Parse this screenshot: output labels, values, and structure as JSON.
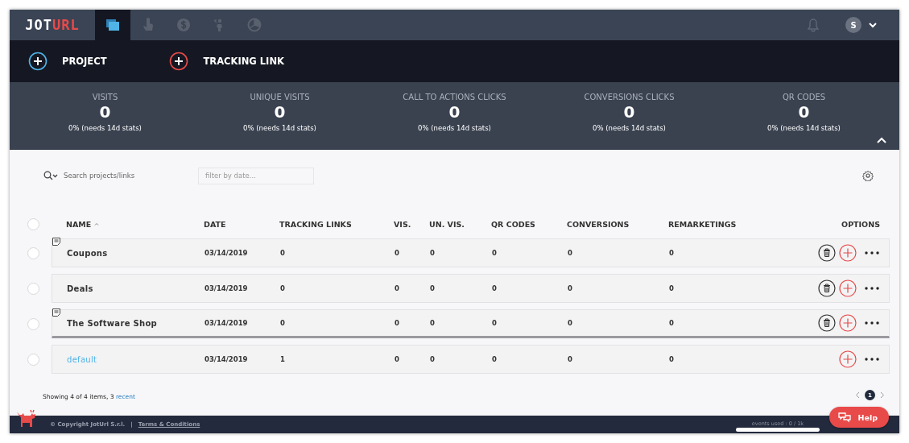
{
  "topbar": {
    "logo": {
      "left": "JOT",
      "right": "URL"
    },
    "tabs": [
      {
        "kind": "folder",
        "selected": true
      },
      {
        "kind": "hand",
        "selected": false
      },
      {
        "kind": "dollar",
        "selected": false
      },
      {
        "kind": "person",
        "selected": false
      },
      {
        "kind": "pie",
        "selected": false
      }
    ],
    "user": {
      "initial": "S"
    }
  },
  "actions": [
    {
      "label": "PROJECT",
      "color": "#4fb3e8"
    },
    {
      "label": "TRACKING LINK",
      "color": "#e84a4a"
    }
  ],
  "stats": [
    {
      "label": "VISITS",
      "value": "0",
      "note": "0% (needs 14d stats)"
    },
    {
      "label": "UNIQUE VISITS",
      "value": "0",
      "note": "0% (needs 14d stats)"
    },
    {
      "label": "CALL TO ACTIONS CLICKS",
      "value": "0",
      "note": "0% (needs 14d stats)"
    },
    {
      "label": "CONVERSIONS CLICKS",
      "value": "0",
      "note": "0% (needs 14d stats)"
    },
    {
      "label": "QR CODES",
      "value": "0",
      "note": "0% (needs 14d stats)"
    }
  ],
  "filters": {
    "search_placeholder": "Search projects/links",
    "date_placeholder": "filter by date..."
  },
  "table": {
    "all_checked": false,
    "columns": [
      {
        "label": "NAME",
        "sorted": true
      },
      {
        "label": "DATE",
        "sorted": false
      },
      {
        "label": "TRACKING LINKS",
        "sorted": false
      },
      {
        "label": "VIS.",
        "sorted": false
      },
      {
        "label": "UN. VIS.",
        "sorted": false
      },
      {
        "label": "QR CODES",
        "sorted": false
      },
      {
        "label": "CONVERSIONS",
        "sorted": false
      },
      {
        "label": "REMARKETINGS",
        "sorted": false
      },
      {
        "label": "OPTIONS",
        "sorted": false
      }
    ],
    "rows": [
      {
        "name": "Coupons",
        "date": "03/14/2019",
        "tracking_links": "0",
        "vis": "0",
        "un_vis": "0",
        "qr_codes": "0",
        "conversions": "0",
        "remarketings": "0",
        "checked": false,
        "has_note": true,
        "deletable": true,
        "is_default": false,
        "highlighted": false
      },
      {
        "name": "Deals",
        "date": "03/14/2019",
        "tracking_links": "0",
        "vis": "0",
        "un_vis": "0",
        "qr_codes": "0",
        "conversions": "0",
        "remarketings": "0",
        "checked": false,
        "has_note": false,
        "deletable": true,
        "is_default": false,
        "highlighted": false
      },
      {
        "name": "The Software Shop",
        "date": "03/14/2019",
        "tracking_links": "0",
        "vis": "0",
        "un_vis": "0",
        "qr_codes": "0",
        "conversions": "0",
        "remarketings": "0",
        "checked": false,
        "has_note": true,
        "deletable": true,
        "is_default": false,
        "highlighted": true
      },
      {
        "name": "default",
        "date": "03/14/2019",
        "tracking_links": "1",
        "vis": "0",
        "un_vis": "0",
        "qr_codes": "0",
        "conversions": "0",
        "remarketings": "0",
        "checked": false,
        "has_note": false,
        "deletable": false,
        "is_default": true,
        "highlighted": false
      }
    ]
  },
  "summary": {
    "text": "Showing 4 of 4 items, 3",
    "link": "recent"
  },
  "pagination": {
    "pages": [
      {
        "label": "1",
        "selected": true
      }
    ]
  },
  "footer": {
    "copyright": "© Copyright JotUrl S.r.l.",
    "separator": "|",
    "terms": "Terms & Conditions",
    "events": {
      "label": "events used : 0 / 1k",
      "level": 0
    }
  },
  "help": {
    "label": "Help"
  }
}
